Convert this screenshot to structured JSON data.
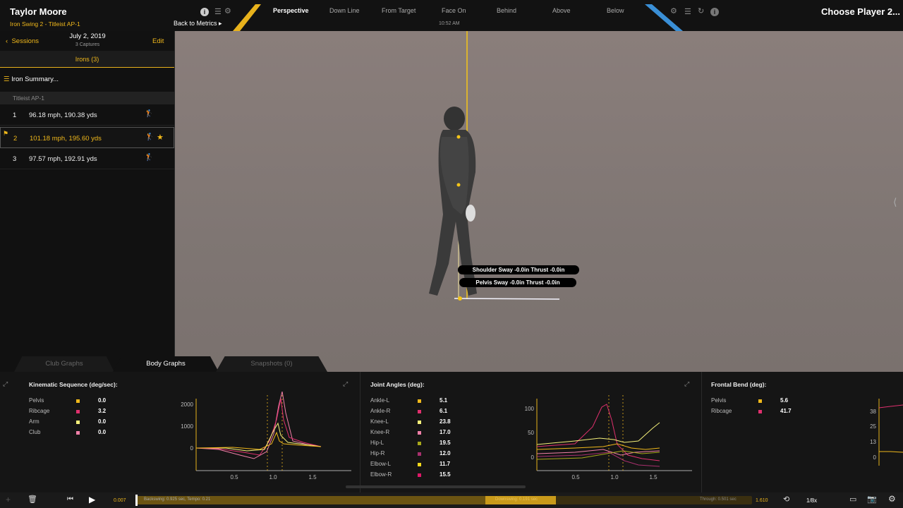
{
  "header": {
    "player_name": "Taylor Moore",
    "swing_title": "Iron Swing 2 - Titleist AP-1",
    "back_label": "Back to Metrics",
    "choose_player": "Choose Player 2...",
    "timestamp": "10:52 AM"
  },
  "views": [
    "Perspective",
    "Down Line",
    "From Target",
    "Face On",
    "Behind",
    "Above",
    "Below"
  ],
  "session": {
    "back_label": "Sessions",
    "date": "July 2, 2019",
    "captures": "3 Captures",
    "edit_label": "Edit",
    "club_filter": "Irons (3)",
    "summary_label": "Iron Summary...",
    "group_label": "Titleist AP-1"
  },
  "swings": [
    {
      "num": "1",
      "value": "96.18 mph, 190.38 yds"
    },
    {
      "num": "2",
      "value": "101.18 mph, 195.60 yds"
    },
    {
      "num": "3",
      "value": "97.57 mph, 192.91 yds"
    }
  ],
  "overlay": {
    "shoulder": "Shoulder Sway -0.0in Thrust -0.0in",
    "pelvis": "Pelvis Sway -0.0in Thrust -0.0in"
  },
  "tabs": [
    "Club Graphs",
    "Body Graphs",
    "Snapshots (0)"
  ],
  "kinematic": {
    "title": "Kinematic Sequence (deg/sec):",
    "items": [
      {
        "label": "Pelvis",
        "value": "0.0",
        "color": "#f0b81b"
      },
      {
        "label": "Ribcage",
        "value": "3.2",
        "color": "#e0306e"
      },
      {
        "label": "Arm",
        "value": "0.0",
        "color": "#f5f07a"
      },
      {
        "label": "Club",
        "value": "0.0",
        "color": "#f07fa8"
      }
    ],
    "y_ticks": [
      "2000",
      "1000",
      "0"
    ],
    "x_ticks": [
      "0.5",
      "1.0",
      "1.5"
    ]
  },
  "joints": {
    "title": "Joint Angles (deg):",
    "items": [
      {
        "label": "Ankle-L",
        "value": "5.1",
        "color": "#f0b81b"
      },
      {
        "label": "Ankle-R",
        "value": "6.1",
        "color": "#e0306e"
      },
      {
        "label": "Knee-L",
        "value": "23.8",
        "color": "#f5f07a"
      },
      {
        "label": "Knee-R",
        "value": "17.0",
        "color": "#f07fa8"
      },
      {
        "label": "Hip-L",
        "value": "19.5",
        "color": "#a8a81b"
      },
      {
        "label": "Hip-R",
        "value": "12.0",
        "color": "#a8306e"
      },
      {
        "label": "Elbow-L",
        "value": "11.7",
        "color": "#f5d81b"
      },
      {
        "label": "Elbow-R",
        "value": "15.5",
        "color": "#e01868"
      }
    ],
    "y_ticks": [
      "100",
      "50",
      "0"
    ],
    "x_ticks": [
      "0.5",
      "1.0",
      "1.5"
    ]
  },
  "frontal": {
    "title": "Frontal Bend (deg):",
    "items": [
      {
        "label": "Pelvis",
        "value": "5.6",
        "color": "#f0b81b"
      },
      {
        "label": "Ribcage",
        "value": "41.7",
        "color": "#e0306e"
      }
    ],
    "y_ticks": [
      "38",
      "25",
      "13",
      "0"
    ]
  },
  "timeline": {
    "start": "0.007",
    "backswing": "Backswing: 0.925 sec, Tempo: 0.21",
    "downswing": "Downswing: 0.191 sec",
    "through": "Through: 0.501 sec",
    "end": "1.610",
    "speed": "1/8x",
    "progress": 0.0
  }
}
